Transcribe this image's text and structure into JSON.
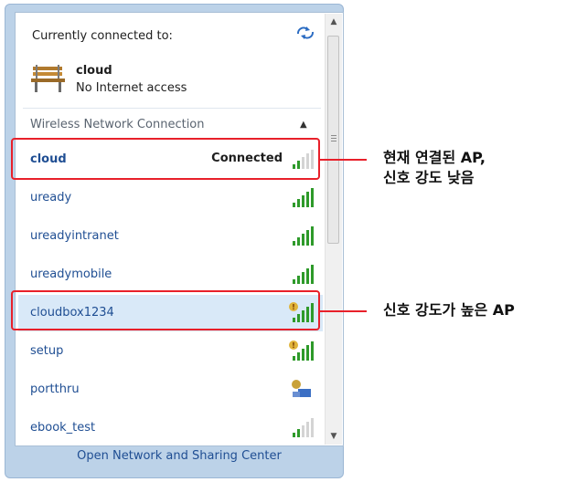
{
  "header": {
    "title": "Currently connected to:",
    "connected_name": "cloud",
    "connected_status": "No Internet access"
  },
  "section": {
    "label": "Wireless Network Connection"
  },
  "networks": [
    {
      "name": "cloud",
      "state": "Connected",
      "signal_bars_filled": 2,
      "secured": false
    },
    {
      "name": "uready",
      "state": "",
      "signal_bars_filled": 5,
      "secured": false
    },
    {
      "name": "ureadyintranet",
      "state": "",
      "signal_bars_filled": 5,
      "secured": false
    },
    {
      "name": "ureadymobile",
      "state": "",
      "signal_bars_filled": 5,
      "secured": false
    },
    {
      "name": "cloudbox1234",
      "state": "",
      "signal_bars_filled": 5,
      "secured": true
    },
    {
      "name": "setup",
      "state": "",
      "signal_bars_filled": 5,
      "secured": true
    },
    {
      "name": "portthru",
      "state": "",
      "signal_bars_filled": 0,
      "secured": true
    },
    {
      "name": "ebook_test",
      "state": "",
      "signal_bars_filled": 2,
      "secured": false
    }
  ],
  "footer": {
    "link_label": "Open Network and Sharing Center"
  },
  "annotations": {
    "connected_ap_line1": "현재 연결된 AP,",
    "connected_ap_line2": "신호 강도 낮음",
    "strong_ap": "신호 강도가 높은 AP"
  },
  "colors": {
    "link": "#1f4e93",
    "highlight": "#e8202a",
    "signal_green": "#2e9a2a",
    "frame": "#bcd2e8"
  }
}
